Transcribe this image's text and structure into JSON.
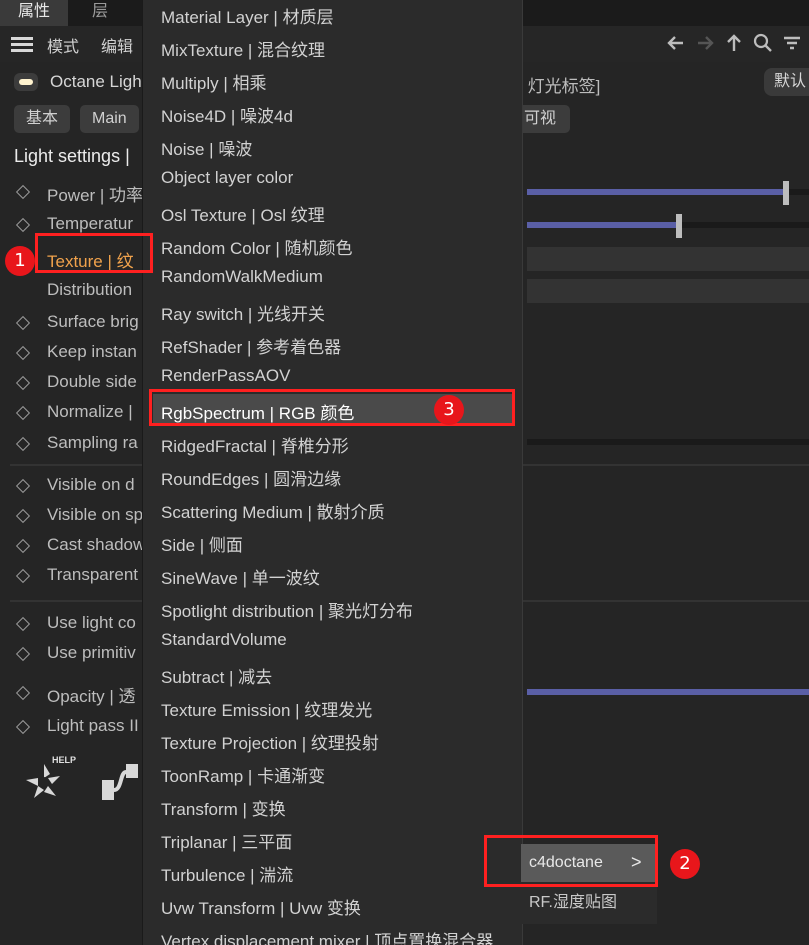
{
  "top_tabs": [
    "属性",
    "层"
  ],
  "menubar": {
    "items": [
      "模式",
      "编辑"
    ],
    "icons": [
      "back-arrow-icon",
      "forward-arrow-icon",
      "up-arrow-icon",
      "search-icon",
      "filter-icon"
    ]
  },
  "object": {
    "name": "Octane Ligh",
    "tag": "ne 灯光标签]",
    "default_button": "默认"
  },
  "sub_tabs": [
    "基本",
    "Main",
    "可视"
  ],
  "section": {
    "title": "Light settings |"
  },
  "attributes": [
    {
      "label": "Power | 功率"
    },
    {
      "label": "Temperatur"
    },
    {
      "label": "Texture | 纹"
    },
    {
      "label": "Distribution"
    },
    {
      "label": "Surface brig"
    },
    {
      "label": "Keep instan"
    },
    {
      "label": "Double side"
    },
    {
      "label": "Normalize |"
    },
    {
      "label": "Sampling ra"
    },
    {
      "label": "Visible on d"
    },
    {
      "label": "Visible on sp"
    },
    {
      "label": "Cast shadow"
    },
    {
      "label": "Transparent"
    },
    {
      "label": "Use light co"
    },
    {
      "label": "Use primitiv"
    },
    {
      "label": "Opacity | 透"
    },
    {
      "label": "Light pass II"
    }
  ],
  "help_label": "HELP",
  "popup_menu": {
    "items": [
      "Material Layer | 材质层",
      "MixTexture | 混合纹理",
      "Multiply | 相乘",
      "Noise4D | 噪波4d",
      "Noise | 噪波",
      "Object layer color",
      "Osl Texture | Osl 纹理",
      "Random Color | 随机颜色",
      "RandomWalkMedium",
      "Ray switch | 光线开关",
      "RefShader | 参考着色器",
      "RenderPassAOV",
      "RgbSpectrum | RGB 颜色",
      "RidgedFractal | 脊椎分形",
      "RoundEdges | 圆滑边缘",
      "Scattering Medium | 散射介质",
      "Side | 侧面",
      "SineWave | 单一波纹",
      "Spotlight distribution | 聚光灯分布",
      "StandardVolume",
      "Subtract | 减去",
      "Texture Emission | 纹理发光",
      "Texture Projection | 纹理投射",
      "ToonRamp | 卡通渐变",
      "Transform | 变换",
      "Triplanar | 三平面",
      "Turbulence | 湍流",
      "Uvw Transform | Uvw 变换",
      "Vertex displacement mixer | 顶点置换混合器"
    ],
    "highlighted": "RgbSpectrum | RGB 颜色"
  },
  "submenu": {
    "items": [
      "c4doctane",
      "RF.湿度贴图"
    ],
    "arrow": ">"
  },
  "sliders": [
    {
      "fill": 0.93
    },
    {
      "fill": 0.55
    },
    {
      "fill": 1.0
    }
  ],
  "badges": [
    "1",
    "2",
    "3"
  ],
  "colors": {
    "accent_orange": "#f0a24c",
    "highlight_red": "#ff2020",
    "slider_blue": "#5a5fa6"
  }
}
